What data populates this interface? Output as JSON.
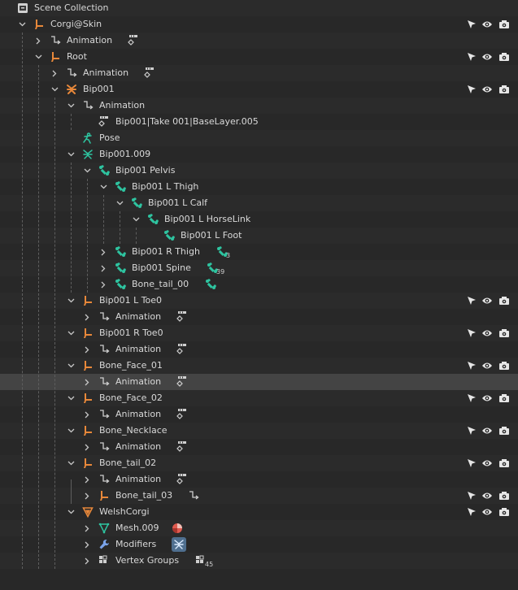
{
  "app": {
    "panel": "Outliner"
  },
  "rows": [
    {
      "label": "Scene Collection",
      "icon": "scene-collection-icon",
      "expand": "none",
      "restrict": false
    },
    {
      "label": "Corgi@Skin",
      "icon": "armature-data-icon",
      "expand": "open",
      "restrict": true
    },
    {
      "label": "Animation",
      "icon": "animation-icon",
      "expand": "closed",
      "restrict": false,
      "child": "action-icon"
    },
    {
      "label": "Root",
      "icon": "armature-data-icon",
      "expand": "open",
      "restrict": true
    },
    {
      "label": "Animation",
      "icon": "animation-icon",
      "expand": "closed",
      "restrict": false,
      "child": "action-icon"
    },
    {
      "label": "Bip001",
      "icon": "armature-object-icon",
      "expand": "open",
      "restrict": true
    },
    {
      "label": "Animation",
      "icon": "animation-icon",
      "expand": "open",
      "restrict": false
    },
    {
      "label": "Bip001|Take 001|BaseLayer.005",
      "icon": "action-icon",
      "expand": "none",
      "restrict": false
    },
    {
      "label": "Pose",
      "icon": "pose-icon",
      "expand": "none",
      "restrict": false
    },
    {
      "label": "Bip001.009",
      "icon": "armature-icon",
      "expand": "open",
      "restrict": false
    },
    {
      "label": "Bip001 Pelvis",
      "icon": "bone-icon",
      "expand": "open",
      "restrict": false
    },
    {
      "label": "Bip001 L Thigh",
      "icon": "bone-icon",
      "expand": "open",
      "restrict": false
    },
    {
      "label": "Bip001 L Calf",
      "icon": "bone-icon",
      "expand": "open",
      "restrict": false
    },
    {
      "label": "Bip001 L HorseLink",
      "icon": "bone-icon",
      "expand": "open",
      "restrict": false
    },
    {
      "label": "Bip001 L Foot",
      "icon": "bone-icon",
      "expand": "none",
      "restrict": false
    },
    {
      "label": "Bip001 R Thigh",
      "icon": "bone-icon",
      "expand": "closed",
      "restrict": false,
      "child": "bone-icon",
      "count": "3"
    },
    {
      "label": "Bip001 Spine",
      "icon": "bone-icon",
      "expand": "closed",
      "restrict": false,
      "child": "bone-icon",
      "count": "39"
    },
    {
      "label": "Bone_tail_00",
      "icon": "bone-icon",
      "expand": "closed",
      "restrict": false,
      "child": "bone-icon"
    },
    {
      "label": "Bip001 L Toe0",
      "icon": "armature-data-icon",
      "expand": "open",
      "restrict": true
    },
    {
      "label": "Animation",
      "icon": "animation-icon",
      "expand": "closed",
      "restrict": false,
      "child": "action-icon"
    },
    {
      "label": "Bip001 R Toe0",
      "icon": "armature-data-icon",
      "expand": "open",
      "restrict": true
    },
    {
      "label": "Animation",
      "icon": "animation-icon",
      "expand": "closed",
      "restrict": false,
      "child": "action-icon"
    },
    {
      "label": "Bone_Face_01",
      "icon": "armature-data-icon",
      "expand": "open",
      "restrict": true
    },
    {
      "label": "Animation",
      "icon": "animation-icon",
      "expand": "closed",
      "restrict": false,
      "child": "action-icon",
      "highlight": true
    },
    {
      "label": "Bone_Face_02",
      "icon": "armature-data-icon",
      "expand": "open",
      "restrict": true
    },
    {
      "label": "Animation",
      "icon": "animation-icon",
      "expand": "closed",
      "restrict": false,
      "child": "action-icon"
    },
    {
      "label": "Bone_Necklace",
      "icon": "armature-data-icon",
      "expand": "open",
      "restrict": true
    },
    {
      "label": "Animation",
      "icon": "animation-icon",
      "expand": "closed",
      "restrict": false,
      "child": "action-icon"
    },
    {
      "label": "Bone_tail_02",
      "icon": "armature-data-icon",
      "expand": "open",
      "restrict": true
    },
    {
      "label": "Animation",
      "icon": "animation-icon",
      "expand": "closed",
      "restrict": false,
      "child": "action-icon"
    },
    {
      "label": "Bone_tail_03",
      "icon": "armature-data-icon",
      "expand": "closed",
      "restrict": true,
      "child": "animation-icon"
    },
    {
      "label": "WelshCorgi",
      "icon": "mesh-object-icon",
      "expand": "open",
      "restrict": true
    },
    {
      "label": "Mesh.009",
      "icon": "mesh-data-icon",
      "expand": "closed",
      "restrict": false,
      "child": "material-icon"
    },
    {
      "label": "Modifiers",
      "icon": "wrench-icon",
      "expand": "closed",
      "restrict": false,
      "child": "armature-modifier-icon"
    },
    {
      "label": "Vertex Groups",
      "icon": "vertex-groups-icon",
      "expand": "closed",
      "restrict": false,
      "child": "vertex-groups-icon",
      "count": "45"
    }
  ],
  "colors": {
    "object_orange": "#e8883a",
    "bone_green": "#2ec4a0",
    "text": "#d9d9d9",
    "highlight": "#444444"
  }
}
